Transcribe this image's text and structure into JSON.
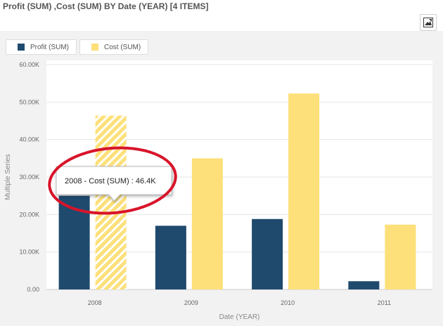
{
  "header": {
    "title": "Profit (SUM) ,Cost (SUM) BY Date (YEAR) [4 ITEMS]",
    "export_icon": "image-export-icon"
  },
  "colors": {
    "profit": "#1f4a6e",
    "cost": "#fde07a",
    "hatch": "#ffffff",
    "annotation": "#d8142a"
  },
  "tooltip": {
    "text": "2008 - Cost (SUM) : 46.4K"
  },
  "chart_data": {
    "type": "bar",
    "categories": [
      "2008",
      "2009",
      "2010",
      "2011"
    ],
    "series": [
      {
        "name": "Profit (SUM)",
        "values": [
          25000,
          17000,
          18800,
          2200
        ]
      },
      {
        "name": "Cost (SUM)",
        "values": [
          46400,
          35000,
          52300,
          17300
        ]
      }
    ],
    "xlabel": "Date (YEAR)",
    "ylabel": "Multiple Series",
    "ylim": [
      0,
      60000
    ],
    "yticks": [
      "0.00",
      "10.00K",
      "20.00K",
      "30.00K",
      "40.00K",
      "50.00K",
      "60.00K"
    ],
    "grid": true,
    "legend": "top-left",
    "highlighted": {
      "series": 1,
      "category": 0
    }
  }
}
